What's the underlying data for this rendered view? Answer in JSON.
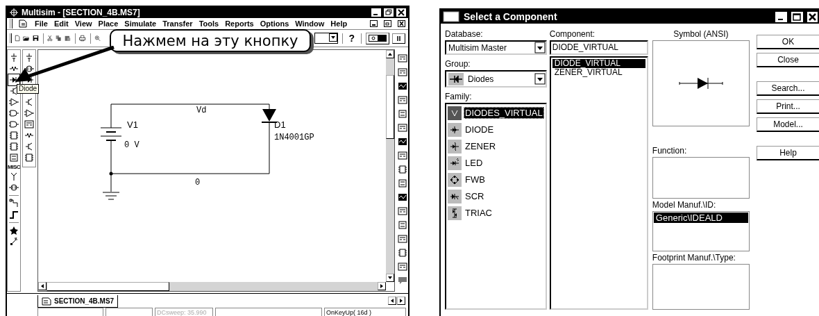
{
  "main_window": {
    "title": "Multisim - [SECTION_4B.MS7]",
    "menus": [
      "File",
      "Edit",
      "View",
      "Place",
      "Simulate",
      "Transfer",
      "Tools",
      "Reports",
      "Options",
      "Window",
      "Help"
    ],
    "toolbar": {
      "help": "?"
    },
    "tooltip": "Diode",
    "component_toolbar": {
      "misc_label": "MISC"
    },
    "schematic": {
      "nets": [
        {
          "label": "Vd"
        },
        {
          "label": "0"
        }
      ],
      "source": {
        "ref": "V1",
        "value": "0 V"
      },
      "diode": {
        "ref": "D1",
        "model": "1N4001GP"
      }
    },
    "sheet_tabs": [
      {
        "label": "SECTION_4B.MS7",
        "selected": true
      }
    ],
    "status_bar": [
      {
        "text": "DCsweep: 35.990",
        "disabled": true
      },
      {
        "text": "OnKeyUp( 16d )",
        "disabled": false
      }
    ]
  },
  "callout": {
    "text": "Нажмем на эту кнопку"
  },
  "dialog": {
    "title": "Select a Component",
    "database": {
      "label": "Database:",
      "value": "Multisim Master"
    },
    "group": {
      "label": "Group:",
      "value": "Diodes"
    },
    "family": {
      "label": "Family:",
      "items": [
        {
          "label": "DIODES_VIRTUAL",
          "selected": true
        },
        {
          "label": "DIODE",
          "selected": false
        },
        {
          "label": "ZENER",
          "selected": false
        },
        {
          "label": "LED",
          "selected": false
        },
        {
          "label": "FWB",
          "selected": false
        },
        {
          "label": "SCR",
          "selected": false
        },
        {
          "label": "TRIAC",
          "selected": false
        }
      ]
    },
    "component": {
      "label": "Component:",
      "value": "DIODE_VIRTUAL",
      "items": [
        {
          "label": "DIODE_VIRTUAL",
          "selected": true
        },
        {
          "label": "ZENER_VIRTUAL",
          "selected": false
        }
      ]
    },
    "symbol": {
      "label": "Symbol (ANSI)"
    },
    "function": {
      "label": "Function:"
    },
    "model": {
      "label": "Model Manuf.\\ID:",
      "items": [
        {
          "label": "Generic\\IDEALD",
          "selected": true
        }
      ]
    },
    "footprint": {
      "label": "Footprint Manuf.\\Type:"
    },
    "buttons": [
      "OK",
      "Close",
      "Search...",
      "Print...",
      "Model...",
      "Help"
    ]
  }
}
